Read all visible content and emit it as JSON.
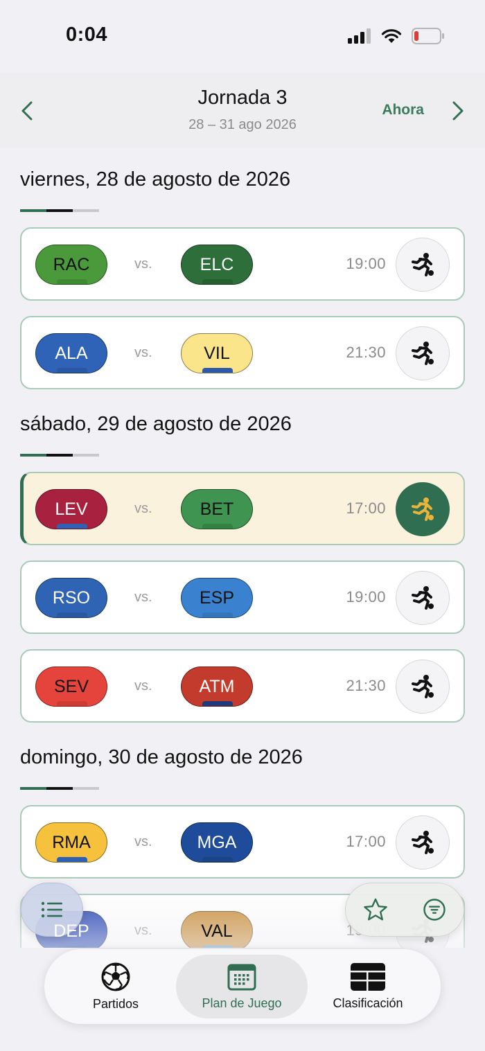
{
  "status_bar": {
    "time": "0:04"
  },
  "header": {
    "title": "Jornada 3",
    "subtitle": "28 – 31 ago 2026",
    "now_label": "Ahora"
  },
  "days": [
    {
      "title": "viernes, 28 de agosto de 2026",
      "matches": [
        {
          "home": "RAC",
          "away": "ELC",
          "vs": "vs.",
          "time": "19:00"
        },
        {
          "home": "ALA",
          "away": "VIL",
          "vs": "vs.",
          "time": "21:30"
        }
      ]
    },
    {
      "title": "sábado, 29 de agosto de 2026",
      "matches": [
        {
          "home": "LEV",
          "away": "BET",
          "vs": "vs.",
          "time": "17:00",
          "highlighted": true
        },
        {
          "home": "RSO",
          "away": "ESP",
          "vs": "vs.",
          "time": "19:00"
        },
        {
          "home": "SEV",
          "away": "ATM",
          "vs": "vs.",
          "time": "21:30"
        }
      ]
    },
    {
      "title": "domingo, 30 de agosto de 2026",
      "matches": [
        {
          "home": "RMA",
          "away": "MGA",
          "vs": "vs.",
          "time": "17:00"
        },
        {
          "home": "DEP",
          "away": "VAL",
          "vs": "vs.",
          "time": "19:00"
        }
      ]
    }
  ],
  "team_colors": {
    "RAC": {
      "bg": "#4a9a3c",
      "fg": "#111111",
      "stripe": "#3d8a30"
    },
    "ELC": {
      "bg": "#2e6e3a",
      "fg": "#ffffff",
      "stripe": "#276030"
    },
    "ALA": {
      "bg": "#2f63b8",
      "fg": "#ffffff",
      "stripe": "#2a57a3"
    },
    "VIL": {
      "bg": "#fbe58a",
      "fg": "#111111",
      "stripe": "#2c5aa8"
    },
    "LEV": {
      "bg": "#a8223f",
      "fg": "#ffffff",
      "stripe": "#2f60b4"
    },
    "BET": {
      "bg": "#3e9450",
      "fg": "#111111",
      "stripe": "#338244"
    },
    "RSO": {
      "bg": "#2f64b4",
      "fg": "#ffffff",
      "stripe": "#2a58a0"
    },
    "ESP": {
      "bg": "#3a82cf",
      "fg": "#111111",
      "stripe": "#3375bb"
    },
    "SEV": {
      "bg": "#e5443c",
      "fg": "#111111",
      "stripe": "#cf3a33"
    },
    "ATM": {
      "bg": "#c23b2c",
      "fg": "#ffffff",
      "stripe": "#1f3a7a"
    },
    "RMA": {
      "bg": "#f6c23e",
      "fg": "#111111",
      "stripe": "#2f60b4"
    },
    "MGA": {
      "bg": "#1f4c9a",
      "fg": "#ffffff",
      "stripe": "#1b4387"
    },
    "DEP": {
      "bg": "#1e3fb0",
      "fg": "#ffffff",
      "stripe": "#1a389c"
    },
    "VAL": {
      "bg": "#c88a32",
      "fg": "#111111",
      "stripe": "#4aa0d8"
    }
  },
  "tabs": [
    {
      "label": "Partidos",
      "icon": "soccer-ball-icon"
    },
    {
      "label": "Plan de Juego",
      "icon": "calendar-icon",
      "selected": true
    },
    {
      "label": "Clasificación",
      "icon": "table-icon"
    }
  ],
  "colors": {
    "accent": "#2f6e51",
    "card_border": "#a8cbb8",
    "highlight_bg": "#fbf2dd",
    "icon_gold": "#e8b43a"
  }
}
